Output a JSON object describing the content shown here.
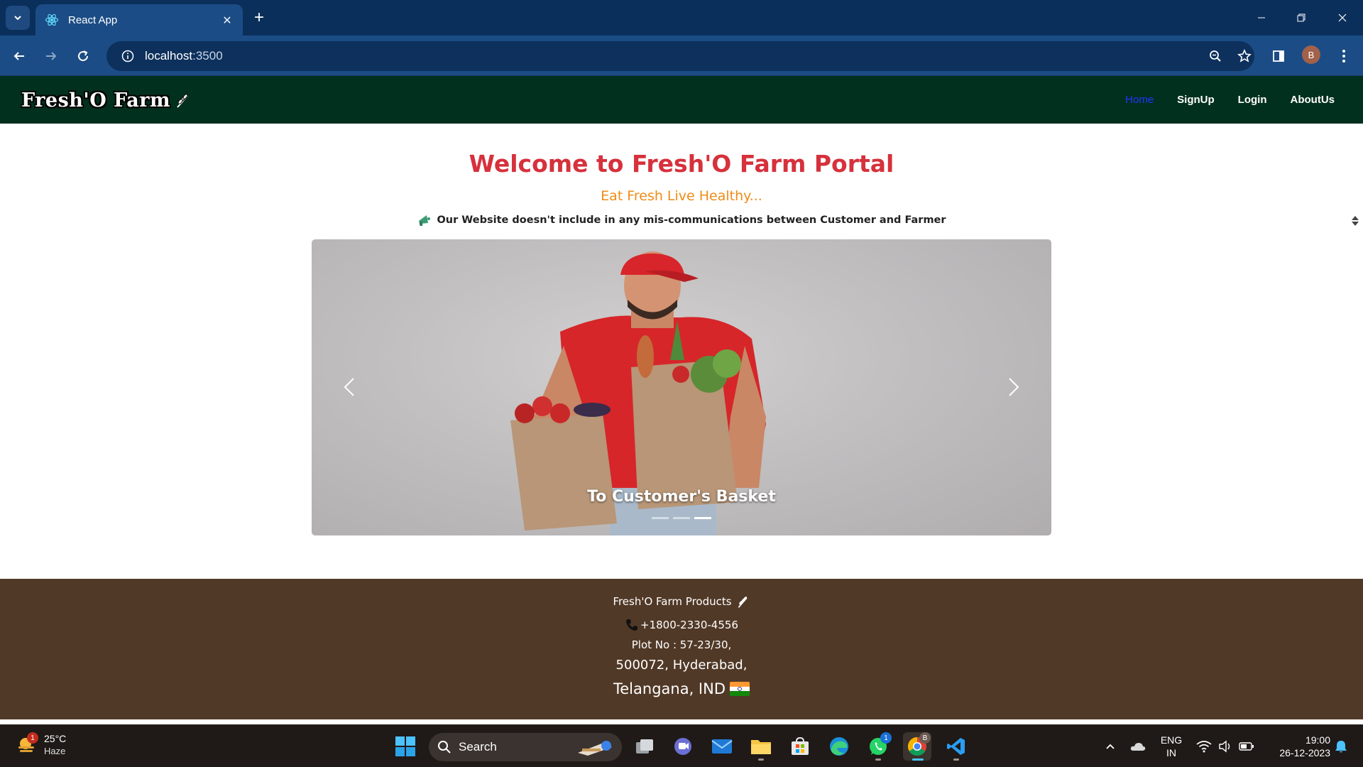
{
  "browser": {
    "tab_title": "React App",
    "url_host": "localhost",
    "url_port": ":3500",
    "profile_initial": "B"
  },
  "navbar": {
    "brand": "Fresh'O Farm",
    "links": [
      {
        "label": "Home",
        "active": true
      },
      {
        "label": "SignUp",
        "active": false
      },
      {
        "label": "Login",
        "active": false
      },
      {
        "label": "AboutUs",
        "active": false
      }
    ]
  },
  "main": {
    "title": "Welcome to Fresh'O Farm Portal",
    "tagline": "Eat Fresh Live Healthy...",
    "notice": "Our Website doesn't include in any mis-communications between Customer and Farmer",
    "carousel": {
      "caption": "To Customer's Basket",
      "slide_count": 3,
      "active_slide": 3
    }
  },
  "footer": {
    "brand": "Fresh'O Farm Products",
    "phone": "+1800-2330-4556",
    "plot": "Plot No : 57-23/30,",
    "city": "500072, Hyderabad,",
    "state": "Telangana, IND"
  },
  "taskbar": {
    "weather_temp": "25°C",
    "weather_desc": "Haze",
    "weather_badge": "1",
    "search_label": "Search",
    "whatsapp_badge": "1",
    "chrome_badge": "B",
    "lang_line1": "ENG",
    "lang_line2": "IN",
    "time": "19:00",
    "date": "26-12-2023"
  },
  "colors": {
    "navbar_bg": "#02301e",
    "title": "#d6313c",
    "tagline": "#ef8b17",
    "footer_bg": "#513927",
    "active_link": "#1f34ff"
  }
}
